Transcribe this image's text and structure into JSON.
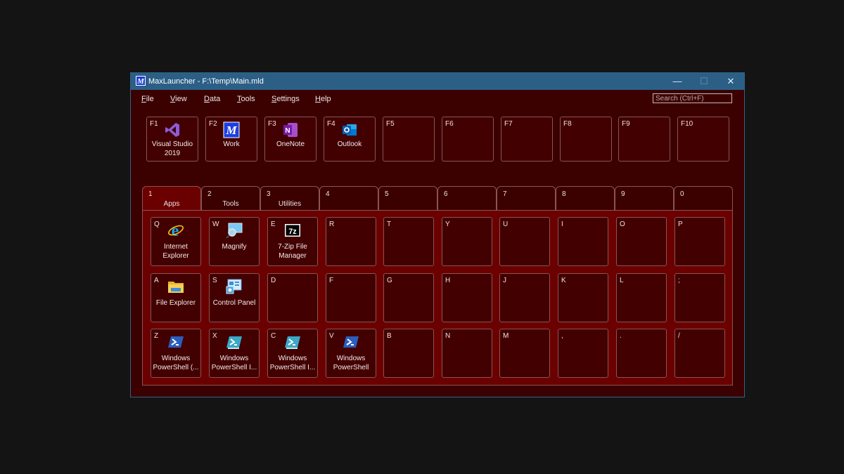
{
  "window": {
    "title": "MaxLauncher - F:\\Temp\\Main.mld",
    "app_icon_letter": "M",
    "minimize": "—",
    "maximize": "☐",
    "close": "✕"
  },
  "menu": {
    "items": [
      "File",
      "View",
      "Data",
      "Tools",
      "Settings",
      "Help"
    ]
  },
  "search": {
    "placeholder": "Search (Ctrl+F)"
  },
  "fkeys": [
    {
      "key": "F1",
      "name": "Visual Studio 2019",
      "icon": "visual-studio-icon"
    },
    {
      "key": "F2",
      "name": "Work",
      "icon": "maxlauncher-icon"
    },
    {
      "key": "F3",
      "name": "OneNote",
      "icon": "onenote-icon"
    },
    {
      "key": "F4",
      "name": "Outlook",
      "icon": "outlook-icon"
    },
    {
      "key": "F5",
      "name": ""
    },
    {
      "key": "F6",
      "name": ""
    },
    {
      "key": "F7",
      "name": ""
    },
    {
      "key": "F8",
      "name": ""
    },
    {
      "key": "F9",
      "name": ""
    },
    {
      "key": "F10",
      "name": ""
    }
  ],
  "tabs": [
    {
      "num": "1",
      "name": "Apps",
      "active": true
    },
    {
      "num": "2",
      "name": "Tools"
    },
    {
      "num": "3",
      "name": "Utilities"
    },
    {
      "num": "4",
      "name": ""
    },
    {
      "num": "5",
      "name": ""
    },
    {
      "num": "6",
      "name": ""
    },
    {
      "num": "7",
      "name": ""
    },
    {
      "num": "8",
      "name": ""
    },
    {
      "num": "9",
      "name": ""
    },
    {
      "num": "0",
      "name": ""
    }
  ],
  "keys": [
    [
      {
        "key": "Q",
        "name": "Internet Explorer",
        "icon": "internet-explorer-icon"
      },
      {
        "key": "W",
        "name": "Magnify",
        "icon": "magnifier-icon"
      },
      {
        "key": "E",
        "name": "7-Zip File Manager",
        "icon": "7zip-icon"
      },
      {
        "key": "R"
      },
      {
        "key": "T"
      },
      {
        "key": "Y"
      },
      {
        "key": "U"
      },
      {
        "key": "I"
      },
      {
        "key": "O"
      },
      {
        "key": "P"
      }
    ],
    [
      {
        "key": "A",
        "name": "File Explorer",
        "icon": "folder-icon"
      },
      {
        "key": "S",
        "name": "Control Panel",
        "icon": "control-panel-icon"
      },
      {
        "key": "D"
      },
      {
        "key": "F"
      },
      {
        "key": "G"
      },
      {
        "key": "H"
      },
      {
        "key": "J"
      },
      {
        "key": "K"
      },
      {
        "key": "L"
      },
      {
        "key": ";"
      }
    ],
    [
      {
        "key": "Z",
        "name": "Windows PowerShell (...",
        "icon": "powershell-icon"
      },
      {
        "key": "X",
        "name": "Windows PowerShell I...",
        "icon": "powershell-ise-icon"
      },
      {
        "key": "C",
        "name": "Windows PowerShell I...",
        "icon": "powershell-ise-icon"
      },
      {
        "key": "V",
        "name": "Windows PowerShell",
        "icon": "powershell-icon"
      },
      {
        "key": "B"
      },
      {
        "key": "N"
      },
      {
        "key": "M"
      },
      {
        "key": ","
      },
      {
        "key": "."
      },
      {
        "key": "/"
      }
    ]
  ]
}
